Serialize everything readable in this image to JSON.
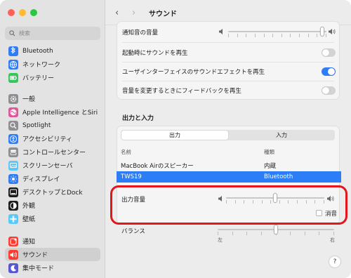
{
  "sidebar": {
    "search_placeholder": "検索",
    "items": [
      {
        "label": "Bluetooth",
        "icon": "bluetooth-icon",
        "color": "#2f7cf6"
      },
      {
        "label": "ネットワーク",
        "icon": "globe-icon",
        "color": "#2f7cf6"
      },
      {
        "label": "バッテリー",
        "icon": "battery-icon",
        "color": "#34c759"
      },
      {
        "label": "一般",
        "icon": "gear-icon",
        "color": "#8e8e93"
      },
      {
        "label": "Apple Intelligence とSiri",
        "icon": "siri-icon",
        "color": "#e0569a"
      },
      {
        "label": "Spotlight",
        "icon": "spotlight-icon",
        "color": "#8e8e93"
      },
      {
        "label": "アクセシビリティ",
        "icon": "accessibility-icon",
        "color": "#2f7cf6"
      },
      {
        "label": "コントロールセンター",
        "icon": "control-center-icon",
        "color": "#8e8e93"
      },
      {
        "label": "スクリーンセーバ",
        "icon": "screensaver-icon",
        "color": "#5ac8fa"
      },
      {
        "label": "ディスプレイ",
        "icon": "display-icon",
        "color": "#2f7cf6"
      },
      {
        "label": "デスクトップとDock",
        "icon": "dock-icon",
        "color": "#1c1c1e"
      },
      {
        "label": "外観",
        "icon": "appearance-icon",
        "color": "#1c1c1e"
      },
      {
        "label": "壁紙",
        "icon": "wallpaper-icon",
        "color": "#5ac8fa"
      },
      {
        "label": "通知",
        "icon": "notifications-icon",
        "color": "#ff3b30"
      },
      {
        "label": "サウンド",
        "icon": "sound-icon",
        "color": "#ff3b30"
      },
      {
        "label": "集中モード",
        "icon": "focus-icon",
        "color": "#5856d6"
      }
    ]
  },
  "header": {
    "title": "サウンド",
    "back": "‹",
    "forward": "›"
  },
  "effects": {
    "alert_volume_label": "通知音の音量",
    "alert_volume_level": 0.98,
    "startup_label": "起動時にサウンドを再生",
    "startup_on": false,
    "ui_effects_label": "ユーザインターフェイスのサウンドエフェクトを再生",
    "ui_effects_on": true,
    "feedback_label": "音量を変更するときにフィードバックを再生",
    "feedback_on": false
  },
  "io": {
    "section_title": "出力と入力",
    "tab_output": "出力",
    "tab_input": "入力",
    "col_name": "名前",
    "col_type": "種類",
    "devices": [
      {
        "name": "MacBook Airのスピーカー",
        "type": "内蔵",
        "selected": false
      },
      {
        "name": "TWS19",
        "type": "Bluetooth",
        "selected": true
      }
    ],
    "output_volume_label": "出力音量",
    "output_volume_level": 0.5,
    "mute_label": "消音",
    "balance_label": "バランス",
    "balance_left": "左",
    "balance_right": "右",
    "balance_level": 0.5
  },
  "help": "?",
  "colors": {
    "accent": "#2d7df6",
    "highlight": "#e3161b",
    "selected_row": "#2d7df6"
  }
}
